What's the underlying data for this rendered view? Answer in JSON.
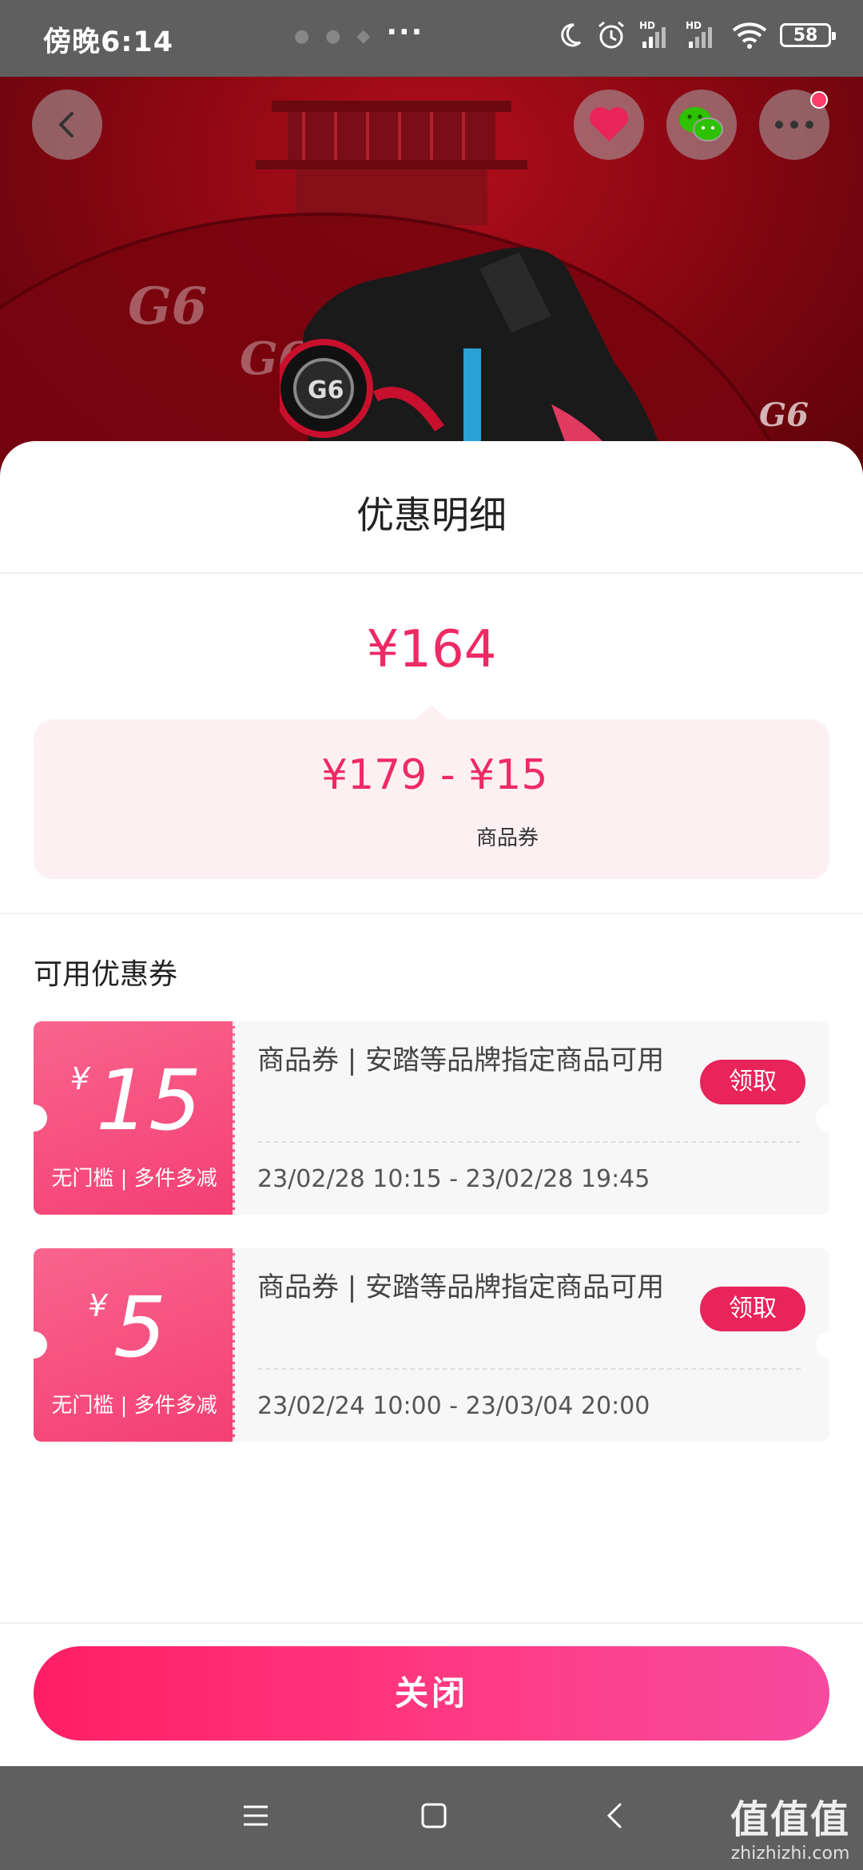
{
  "status_bar": {
    "time": "傍晚6:14",
    "dots": "• • • ···",
    "battery": "58",
    "hd1": "HD",
    "hd2": "HD"
  },
  "hero": {
    "brand_text_1": "G6",
    "brand_text_2": "G6",
    "brand_text_3": "G6",
    "shoe_badge": "G6"
  },
  "top_actions": {
    "back": "back-icon",
    "favorite": "heart-icon",
    "share": "wechat-icon",
    "more": "more-icon"
  },
  "sheet": {
    "title": "优惠明细",
    "final_price": "¥164",
    "calc_expression": "¥179 - ¥15",
    "calc_label": "商品券",
    "section_title": "可用优惠券"
  },
  "coupons": [
    {
      "yen": "¥",
      "amount": "15",
      "condition": "无门槛 | 多件多减",
      "description": "商品券 | 安踏等品牌指定商品可用",
      "time_range": "23/02/28 10:15 - 23/02/28 19:45",
      "claim_label": "领取"
    },
    {
      "yen": "¥",
      "amount": "5",
      "condition": "无门槛 | 多件多减",
      "description": "商品券 | 安踏等品牌指定商品可用",
      "time_range": "23/02/24 10:00 - 23/03/04 20:00",
      "claim_label": "领取"
    }
  ],
  "footer": {
    "close_label": "关闭"
  },
  "nav_bar": {
    "watermark_main": "值值值",
    "watermark_sub": "zhizhizhi.com"
  },
  "colors": {
    "accent": "#ee2a64",
    "coupon_gradient": "#f43f74",
    "button": "#ff1e65"
  }
}
